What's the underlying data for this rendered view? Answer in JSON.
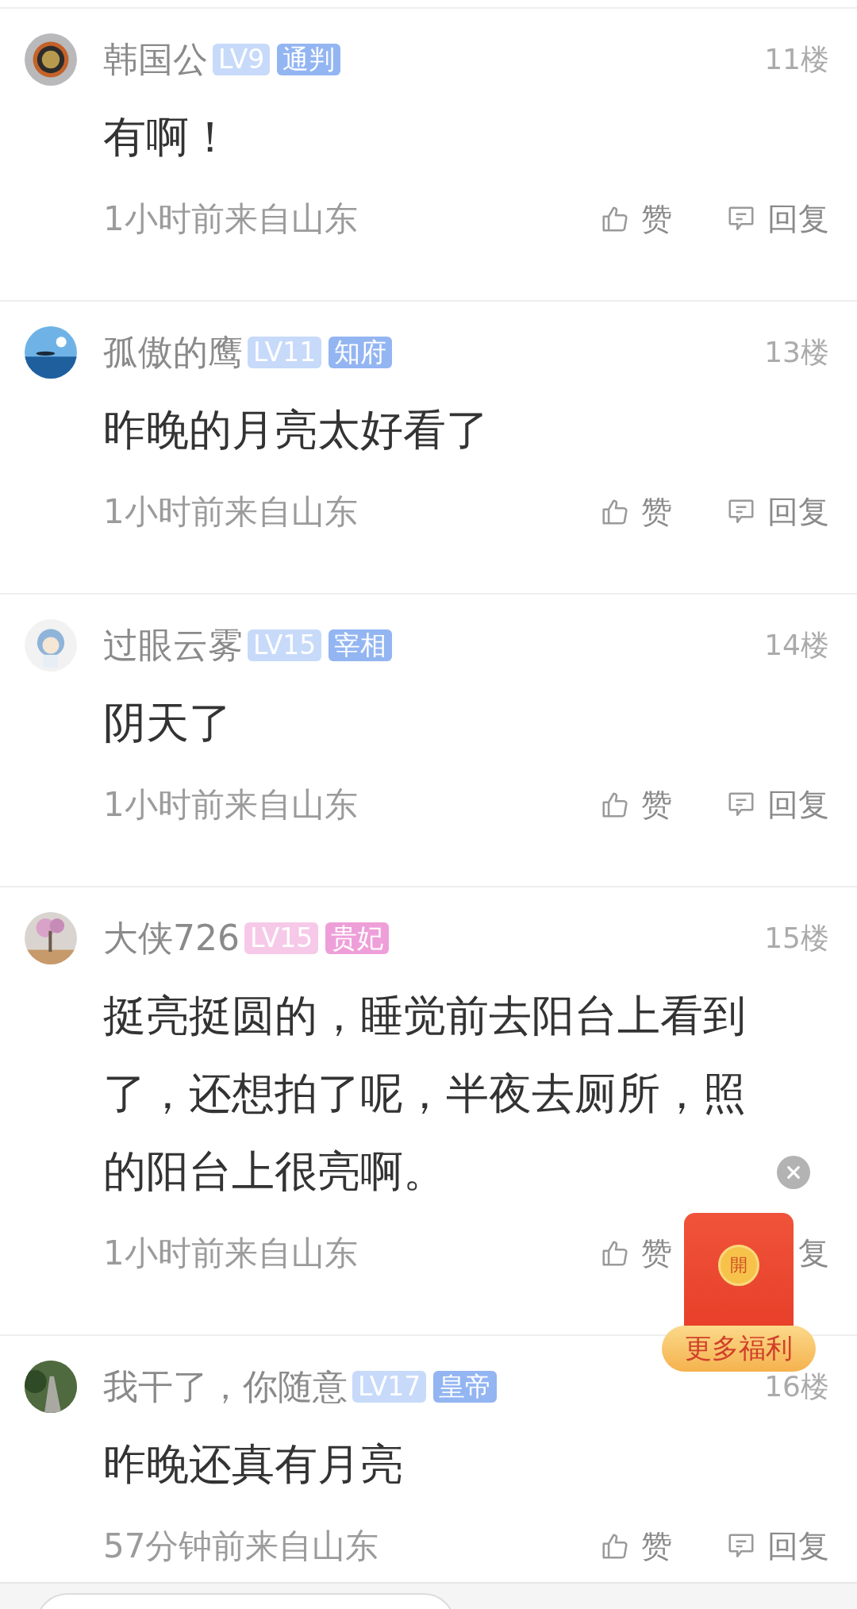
{
  "posts": [
    {
      "name": "韩国公",
      "level_badge": {
        "label": "LV9",
        "color": "#c7dafa"
      },
      "title_badge": {
        "label": "通判",
        "color": "#93b5f2"
      },
      "floor": "11楼",
      "content": "有啊！",
      "meta": "1小时前来自山东",
      "like_label": "赞",
      "reply_label": "回复",
      "reply_icon": true
    },
    {
      "name": "孤傲的鹰",
      "level_badge": {
        "label": "LV11",
        "color": "#c7dafa"
      },
      "title_badge": {
        "label": "知府",
        "color": "#93b5f2"
      },
      "floor": "13楼",
      "content": "昨晚的月亮太好看了",
      "meta": "1小时前来自山东",
      "like_label": "赞",
      "reply_label": "回复",
      "reply_icon": true
    },
    {
      "name": "过眼云雾",
      "level_badge": {
        "label": "LV15",
        "color": "#c7dafa"
      },
      "title_badge": {
        "label": "宰相",
        "color": "#93b5f2"
      },
      "floor": "14楼",
      "content": "阴天了",
      "meta": "1小时前来自山东",
      "like_label": "赞",
      "reply_label": "回复",
      "reply_icon": true
    },
    {
      "name": "大侠726",
      "level_badge": {
        "label": "LV15",
        "color": "#f6c9e8"
      },
      "title_badge": {
        "label": "贵妃",
        "color": "#ee9fd9"
      },
      "floor": "15楼",
      "content": "挺亮挺圆的，睡觉前去阳台上看到了，还想拍了呢，半夜去厕所，照的阳台上很亮啊。",
      "meta": "1小时前来自山东",
      "like_label": "赞",
      "reply_label": "复"
    },
    {
      "name": "我干了，你随意",
      "level_badge": {
        "label": "LV17",
        "color": "#c7dafa"
      },
      "title_badge": {
        "label": "皇帝",
        "color": "#93b5f2"
      },
      "floor": "16楼",
      "content": "昨晚还真有月亮",
      "meta": "57分钟前来自山东",
      "like_label": "赞",
      "reply_label": "回复",
      "reply_icon": true
    }
  ],
  "floating_gift": {
    "coin_label": "開",
    "label": "更多福利"
  },
  "bottom_bar": {
    "kind": "input"
  }
}
